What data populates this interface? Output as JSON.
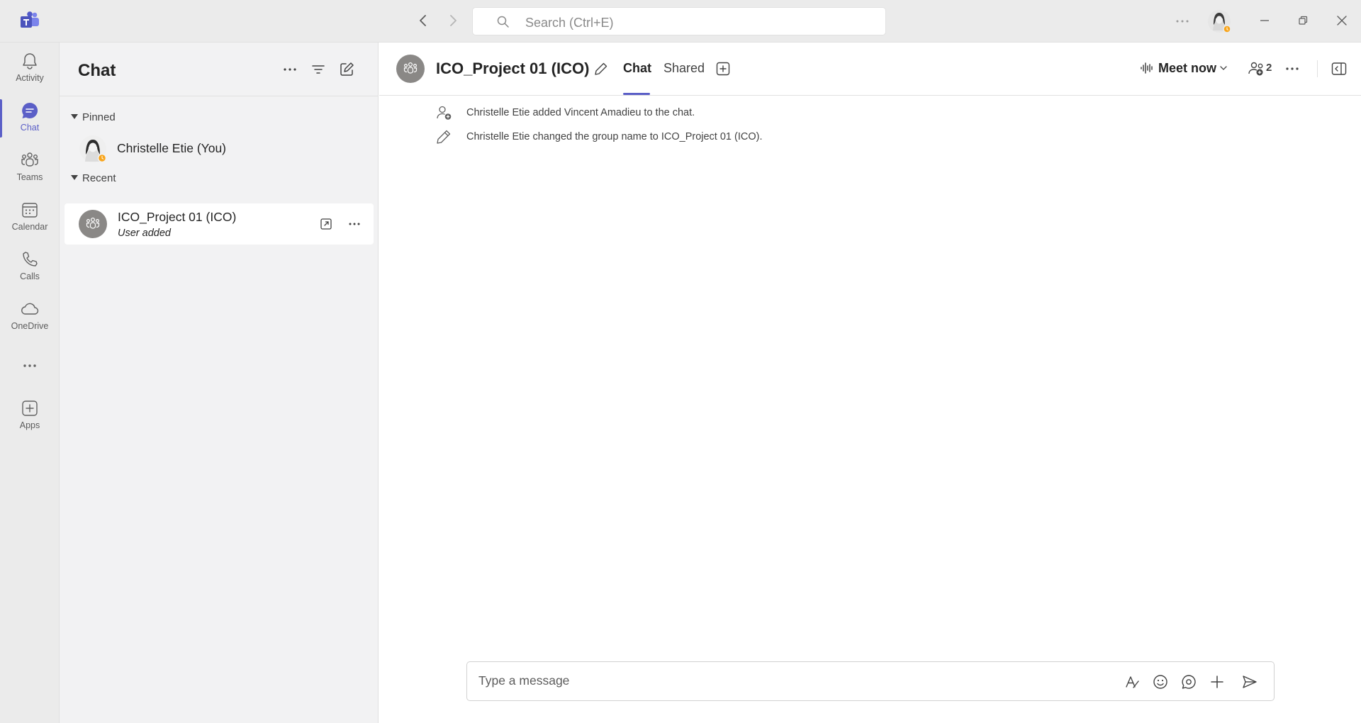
{
  "titlebar": {
    "search_placeholder": "Search (Ctrl+E)"
  },
  "rail": {
    "items": [
      {
        "label": "Activity",
        "icon": "bell-icon"
      },
      {
        "label": "Chat",
        "icon": "chat-icon",
        "active": true
      },
      {
        "label": "Teams",
        "icon": "teams-icon"
      },
      {
        "label": "Calendar",
        "icon": "calendar-icon"
      },
      {
        "label": "Calls",
        "icon": "phone-icon"
      },
      {
        "label": "OneDrive",
        "icon": "cloud-icon"
      },
      {
        "label": "Apps",
        "icon": "add-app-icon"
      }
    ]
  },
  "chat_list": {
    "title": "Chat",
    "pinned_label": "Pinned",
    "pinned": [
      {
        "name": "Christelle Etie (You)",
        "status": "away"
      }
    ],
    "recent_label": "Recent",
    "recent": [
      {
        "name": "ICO_Project 01 (ICO)",
        "preview": "User added"
      }
    ]
  },
  "conversation": {
    "title": "ICO_Project 01 (ICO)",
    "tabs": [
      {
        "label": "Chat",
        "active": true
      },
      {
        "label": "Shared",
        "active": false
      }
    ],
    "meet_now_label": "Meet now",
    "participant_count": "2",
    "events": [
      {
        "icon": "person-add-icon",
        "text": "Christelle Etie added Vincent Amadieu to the chat."
      },
      {
        "icon": "pencil-icon",
        "text": "Christelle Etie changed the group name to ICO_Project 01 (ICO)."
      }
    ],
    "compose_placeholder": "Type a message"
  },
  "colors": {
    "accent": "#5b5fc7",
    "rail_bg": "#ebebeb",
    "list_bg": "#f2f2f3",
    "status_away": "#f8a51c"
  }
}
